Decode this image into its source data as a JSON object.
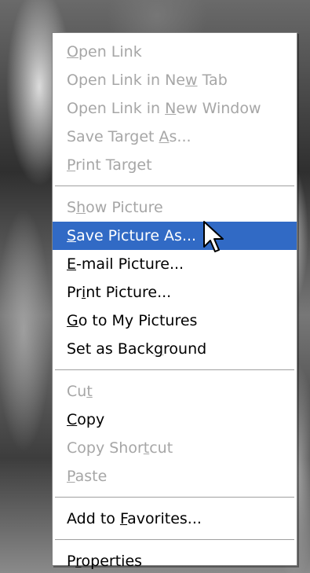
{
  "menu": {
    "groups": [
      [
        {
          "pre": "",
          "ul": "O",
          "post": "pen Link",
          "state": "disabled"
        },
        {
          "pre": "Open Link in Ne",
          "ul": "w",
          "post": " Tab",
          "state": "disabled"
        },
        {
          "pre": "Open Link in ",
          "ul": "N",
          "post": "ew Window",
          "state": "disabled"
        },
        {
          "pre": "Save Target ",
          "ul": "A",
          "post": "s...",
          "state": "disabled"
        },
        {
          "pre": "",
          "ul": "P",
          "post": "rint Target",
          "state": "disabled"
        }
      ],
      [
        {
          "pre": "S",
          "ul": "h",
          "post": "ow Picture",
          "state": "disabled"
        },
        {
          "pre": "",
          "ul": "S",
          "post": "ave Picture As...",
          "state": "highlight"
        },
        {
          "pre": "",
          "ul": "E",
          "post": "-mail Picture...",
          "state": "enabled"
        },
        {
          "pre": "Pr",
          "ul": "i",
          "post": "nt Picture...",
          "state": "enabled"
        },
        {
          "pre": "",
          "ul": "G",
          "post": "o to My Pictures",
          "state": "enabled"
        },
        {
          "pre": "Set as Back",
          "ul": "g",
          "post": "round",
          "state": "enabled"
        }
      ],
      [
        {
          "pre": "Cu",
          "ul": "t",
          "post": "",
          "state": "disabled"
        },
        {
          "pre": "",
          "ul": "C",
          "post": "opy",
          "state": "enabled"
        },
        {
          "pre": "Copy Shor",
          "ul": "t",
          "post": "cut",
          "state": "disabled"
        },
        {
          "pre": "",
          "ul": "P",
          "post": "aste",
          "state": "disabled"
        }
      ],
      [
        {
          "pre": "Add to ",
          "ul": "F",
          "post": "avorites...",
          "state": "enabled"
        }
      ],
      [
        {
          "pre": "P",
          "ul": "r",
          "post": "operties",
          "state": "enabled"
        }
      ]
    ]
  },
  "colors": {
    "highlight": "#316ac5",
    "disabled_text": "#a6a6a6",
    "text": "#000000"
  },
  "cursor": {
    "icon": "arrow-cursor-icon"
  }
}
